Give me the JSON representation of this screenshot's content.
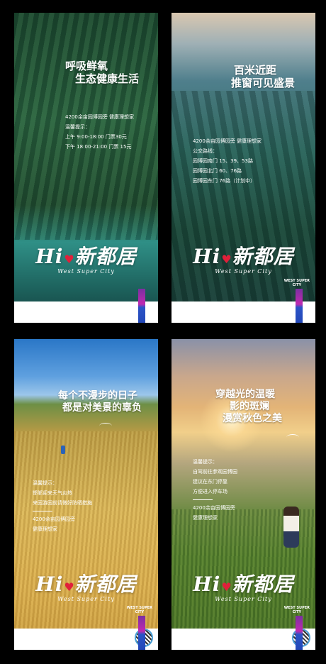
{
  "posters": [
    {
      "headline": [
        "呼吸鲜氧",
        "生态健康生活"
      ],
      "info": [
        "4200余亩园博园旁 健康理想家",
        "温馨提示：",
        "上午 9:00-18:00 门票30元",
        "下午 18:00-21:00 门票 15元"
      ]
    },
    {
      "headline": [
        "百米近距",
        "推窗可见盛景"
      ],
      "info": [
        "4200余亩园博园旁 健康理想家",
        "公交路线：",
        "园博园南门 15、39、53路",
        "园博园北门 60、76路",
        "园博园东门 76路（计划中）"
      ]
    },
    {
      "headline": [
        "每个不漫步的日子",
        "都是对美景的辜负"
      ],
      "info": [
        "温馨提示：",
        "邯郸迎来天气炎热",
        "来园游园前请做好防晒措施",
        "4200余亩园博园旁",
        "健康理想家"
      ]
    },
    {
      "headline": [
        "穿越光的温暖",
        "影的斑斓",
        "漫赏秋色之美"
      ],
      "info": [
        "温馨提示：",
        "自驾前往参观园博园",
        "建议在东门停靠",
        "方便进入停车场",
        "4200余亩园博园旁",
        "健康理想家"
      ]
    }
  ],
  "brand": {
    "logo_hi": "Hi",
    "logo_name": "新都居",
    "logo_sub": "West Super City",
    "tag_line1": "WEST SUPER",
    "tag_line2": "CITY",
    "heart_color": "#e0203a",
    "bar_colors": [
      "#7b2fa1",
      "#2b53c7"
    ]
  }
}
